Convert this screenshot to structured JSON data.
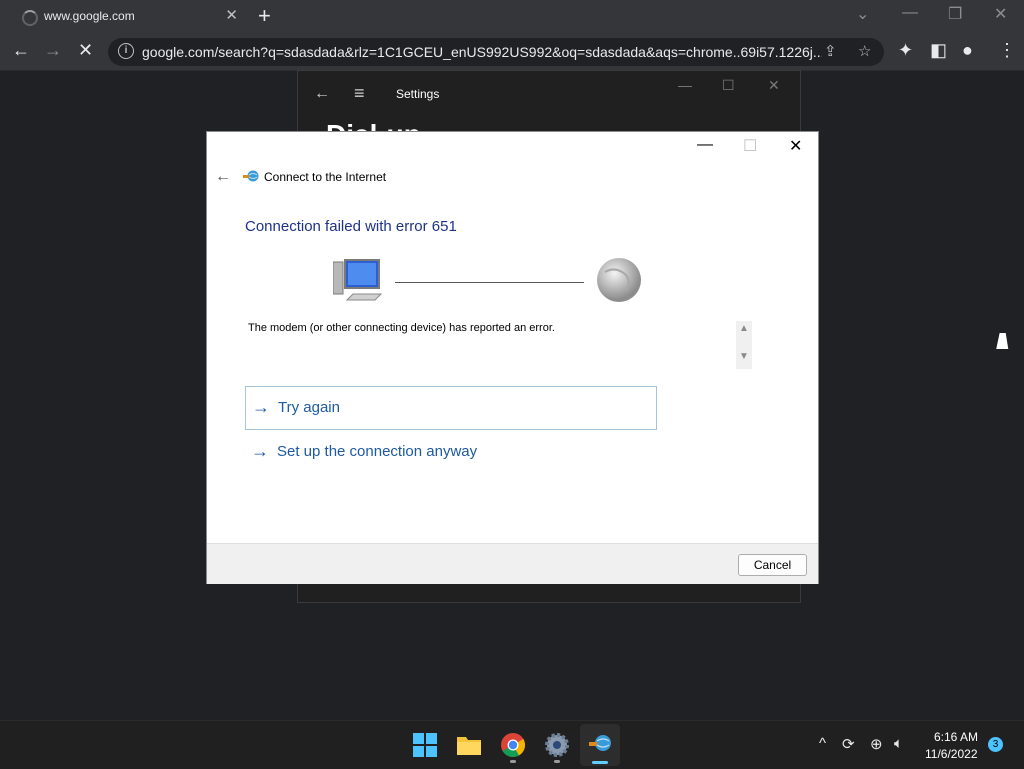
{
  "browser": {
    "tab_title": "www.google.com",
    "url": "google.com/search?q=sdasdada&rlz=1C1GCEU_enUS992US992&oq=sdasdada&aqs=chrome..69i57.1226j..."
  },
  "settings": {
    "title": "Settings",
    "heading": "Dial-up"
  },
  "dialog": {
    "title": "Connect to the Internet",
    "heading": "Connection failed with error 651",
    "message": "The modem (or other connecting device) has reported an error.",
    "try_again": "Try again",
    "setup_anyway": "Set up the connection anyway",
    "cancel": "Cancel"
  },
  "taskbar": {
    "time": "6:16 AM",
    "date": "11/6/2022",
    "notification_count": "3"
  }
}
